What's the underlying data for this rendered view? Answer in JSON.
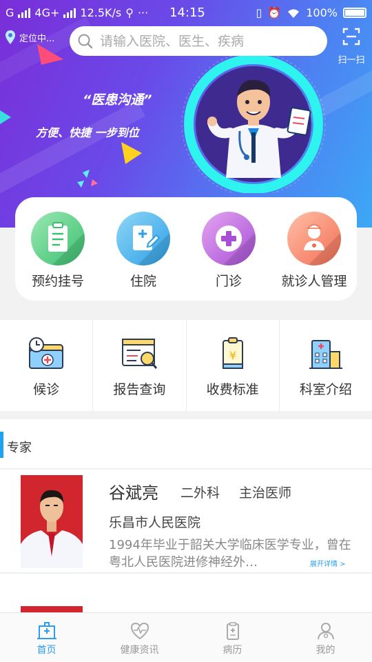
{
  "status_bar": {
    "carrier": "G",
    "network": "4G+",
    "speed": "12.5K/s",
    "more": "···",
    "time": "14:15",
    "battery": "100%"
  },
  "header": {
    "location": "定位中...",
    "search_placeholder": "请输入医院、医生、疾病",
    "scan_label": "扫一扫"
  },
  "banner": {
    "title": "“医患沟通”",
    "subtitle": "方便、快捷  一步到位"
  },
  "quick_services": [
    {
      "label": "预约挂号",
      "icon": "clipboard-icon"
    },
    {
      "label": "住院",
      "icon": "edit-document-icon"
    },
    {
      "label": "门诊",
      "icon": "medical-cross-icon"
    },
    {
      "label": "就诊人管理",
      "icon": "patient-icon"
    }
  ],
  "grid_menu": [
    {
      "label": "候诊",
      "icon": "clock-folder-icon"
    },
    {
      "label": "报告查询",
      "icon": "report-search-icon"
    },
    {
      "label": "收费标准",
      "icon": "fee-icon"
    },
    {
      "label": "科室介绍",
      "icon": "building-icon"
    }
  ],
  "experts": {
    "section_title": "专家",
    "items": [
      {
        "name": "谷斌亮",
        "department": "二外科",
        "title": "主治医师",
        "hospital": "乐昌市人民医院",
        "bio": "1994年毕业于韶关大学临床医学专业，曾在粤北人民医院进修神经外…",
        "more": "展开详情 >"
      }
    ]
  },
  "tabbar": [
    {
      "label": "首页",
      "icon": "hospital-icon",
      "active": true
    },
    {
      "label": "健康资讯",
      "icon": "heart-pulse-icon",
      "active": false
    },
    {
      "label": "病历",
      "icon": "medical-record-icon",
      "active": false
    },
    {
      "label": "我的",
      "icon": "profile-icon",
      "active": false
    }
  ],
  "colors": {
    "accent": "#2a9df4",
    "banner_start": "#7a2ed8",
    "banner_end": "#3ca8f5",
    "photo_bg": "#d2262e"
  }
}
